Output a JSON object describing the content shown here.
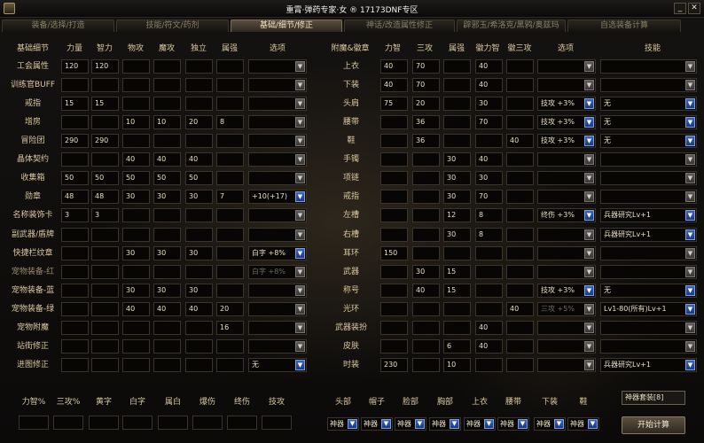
{
  "window": {
    "title": "重霄·弹药专家·女 ® 17173DNF专区",
    "icon": "app-icon",
    "controls": [
      "min-icon",
      "close-icon"
    ]
  },
  "tabs": [
    {
      "label": "装备/选择/打造",
      "active": false
    },
    {
      "label": "技能/符文/药剂",
      "active": false
    },
    {
      "label": "基础/细节/修正",
      "active": true
    },
    {
      "label": "神话/改造属性修正",
      "active": false
    },
    {
      "label": "辟邪玉/希洛克/黑鸦/奥兹玛",
      "active": false
    },
    {
      "label": "自选装备计算",
      "active": false
    }
  ],
  "left": {
    "headers": [
      "基础细节",
      "力量",
      "智力",
      "物攻",
      "魔攻",
      "独立",
      "属强",
      "选项"
    ],
    "rows": [
      {
        "label": "工会属性",
        "values": [
          "120",
          "120",
          "",
          "",
          "",
          ""
        ],
        "option": ""
      },
      {
        "label": "训练官BUFF",
        "values": [
          "",
          "",
          "",
          "",
          "",
          ""
        ],
        "option": ""
      },
      {
        "label": "戒指",
        "values": [
          "15",
          "15",
          "",
          "",
          "",
          ""
        ],
        "option": ""
      },
      {
        "label": "增房",
        "values": [
          "",
          "",
          "10",
          "10",
          "20",
          "8"
        ],
        "option": ""
      },
      {
        "label": "冒险团",
        "values": [
          "290",
          "290",
          "",
          "",
          "",
          ""
        ],
        "option": ""
      },
      {
        "label": "晶体契约",
        "values": [
          "",
          "",
          "40",
          "40",
          "40",
          ""
        ],
        "option": ""
      },
      {
        "label": "收集箱",
        "values": [
          "50",
          "50",
          "50",
          "50",
          "50",
          ""
        ],
        "option": ""
      },
      {
        "label": "勋章",
        "values": [
          "48",
          "48",
          "30",
          "30",
          "30",
          "7"
        ],
        "option": "+10(+17)"
      },
      {
        "label": "名称装饰卡",
        "values": [
          "3",
          "3",
          "",
          "",
          "",
          ""
        ],
        "option": ""
      },
      {
        "label": "副武器/盾牌",
        "values": [
          "",
          "",
          "",
          "",
          "",
          ""
        ],
        "option": ""
      },
      {
        "label": "快捷栏纹章",
        "values": [
          "",
          "",
          "30",
          "30",
          "30",
          ""
        ],
        "option": "白字 +8%"
      },
      {
        "label": "宠物装备-红",
        "values": [
          "",
          "",
          "",
          "",
          "",
          ""
        ],
        "option": "白字 +8%",
        "disabled": true
      },
      {
        "label": "宠物装备-蓝",
        "values": [
          "",
          "",
          "30",
          "30",
          "30",
          ""
        ],
        "option": ""
      },
      {
        "label": "宠物装备-绿",
        "values": [
          "",
          "",
          "40",
          "40",
          "40",
          "20"
        ],
        "option": ""
      },
      {
        "label": "宠物附魔",
        "values": [
          "",
          "",
          "",
          "",
          "",
          "16"
        ],
        "option": ""
      },
      {
        "label": "站街修正",
        "values": [
          "",
          "",
          "",
          "",
          "",
          ""
        ],
        "option": ""
      },
      {
        "label": "进图修正",
        "values": [
          "",
          "",
          "",
          "",
          "",
          ""
        ],
        "option": "无"
      }
    ]
  },
  "right": {
    "headers": [
      "附魔&徽章",
      "力智",
      "三攻",
      "属强",
      "徽力智",
      "徽三攻",
      "选项",
      "技能"
    ],
    "rows": [
      {
        "label": "上衣",
        "values": [
          "40",
          "70",
          "",
          "40",
          ""
        ],
        "option": "",
        "skill": ""
      },
      {
        "label": "下装",
        "values": [
          "40",
          "70",
          "",
          "40",
          ""
        ],
        "option": "",
        "skill": ""
      },
      {
        "label": "头肩",
        "values": [
          "75",
          "20",
          "",
          "30",
          ""
        ],
        "option": "技攻 +3%",
        "skill": "无"
      },
      {
        "label": "腰带",
        "values": [
          "",
          "36",
          "",
          "70",
          ""
        ],
        "option": "技攻 +3%",
        "skill": "无"
      },
      {
        "label": "鞋",
        "values": [
          "",
          "36",
          "",
          "",
          "40"
        ],
        "option": "技攻 +3%",
        "skill": "无"
      },
      {
        "label": "手镯",
        "values": [
          "",
          "",
          "30",
          "40",
          ""
        ],
        "option": "",
        "skill": ""
      },
      {
        "label": "项链",
        "values": [
          "",
          "",
          "30",
          "30",
          ""
        ],
        "option": "",
        "skill": ""
      },
      {
        "label": "戒指",
        "values": [
          "",
          "",
          "30",
          "70",
          ""
        ],
        "option": "",
        "skill": ""
      },
      {
        "label": "左槽",
        "values": [
          "",
          "",
          "12",
          "8",
          ""
        ],
        "option": "终伤 +3%",
        "skill": "兵器研究Lv+1"
      },
      {
        "label": "右槽",
        "values": [
          "",
          "",
          "30",
          "8",
          ""
        ],
        "option": "",
        "skill": "兵器研究Lv+1"
      },
      {
        "label": "耳环",
        "values": [
          "150",
          "",
          "",
          "",
          ""
        ],
        "option": "",
        "skill": ""
      },
      {
        "label": "武器",
        "values": [
          "",
          "30",
          "15",
          "",
          ""
        ],
        "option": "",
        "skill": ""
      },
      {
        "label": "称号",
        "values": [
          "",
          "40",
          "15",
          "",
          ""
        ],
        "option": "技攻 +3%",
        "skill": "无"
      },
      {
        "label": "光环",
        "values": [
          "",
          "",
          "",
          "",
          "40"
        ],
        "option": "三攻 +5%",
        "skill": "Lv1-80(所有)Lv+1",
        "option_disabled": true
      },
      {
        "label": "武器装扮",
        "values": [
          "",
          "",
          "",
          "40",
          ""
        ],
        "option": "",
        "skill": ""
      },
      {
        "label": "皮肤",
        "values": [
          "",
          "",
          "6",
          "40",
          ""
        ],
        "option": "",
        "skill": ""
      },
      {
        "label": "时装",
        "values": [
          "230",
          "",
          "10",
          "",
          ""
        ],
        "option": "",
        "skill": "兵器研究Lv+1"
      }
    ]
  },
  "bottom": {
    "stat_labels": [
      "力智%",
      "三攻%",
      "黄字",
      "白字",
      "属白",
      "爆伤",
      "终伤",
      "技攻"
    ],
    "slot_labels": [
      "头部",
      "帽子",
      "脸部",
      "胸部",
      "上衣",
      "腰带",
      "下装",
      "鞋"
    ],
    "slot_values": [
      "神器",
      "神器",
      "神器",
      "神器",
      "神器",
      "神器",
      "神器",
      "神器"
    ],
    "set_select": "神器套装[8]",
    "calc_button": "开始计算"
  }
}
